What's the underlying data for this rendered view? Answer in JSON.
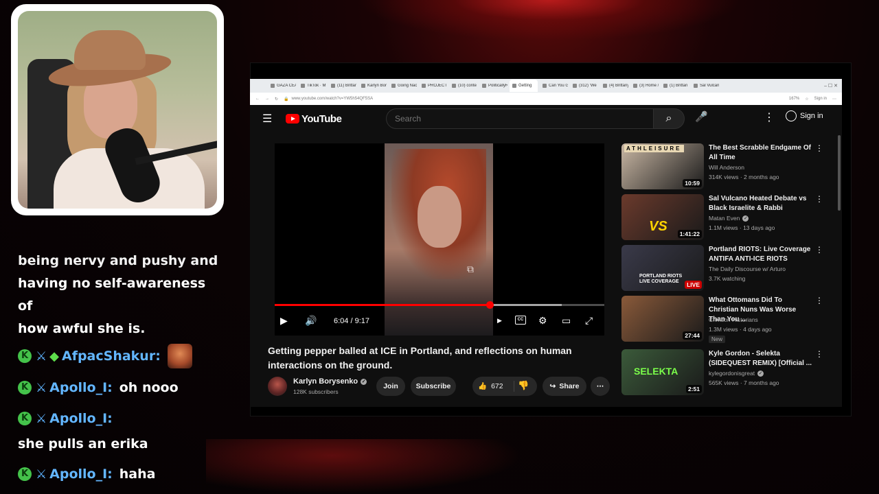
{
  "chat": {
    "clipped_line": "being nervy and pushy and",
    "lines": [
      "having no self-awareness of",
      "how awful she is."
    ],
    "messages": [
      {
        "user": "AfpacShakur:",
        "text": "",
        "has_emote": true
      },
      {
        "user": "Apollo_I:",
        "text": "oh nooo"
      },
      {
        "user": "Apollo_I:",
        "text": "she pulls an erika"
      },
      {
        "user": "Apollo_I:",
        "text": "haha"
      }
    ]
  },
  "browser": {
    "tabs": [
      "GAZA CEA",
      "TikTok · M",
      "(11) Brittan",
      "Karlyn Bory",
      "Going Nac",
      "PROJECT",
      "(10) conte",
      "PoliticallyR",
      "Getting",
      "Can You G",
      "(312) 'We",
      "(4) Brittany",
      "(3) Home /",
      "(1) Brittan",
      "Sal Vulcano"
    ],
    "url": "www.youtube.com/watch?v=YW5h54QF5SA",
    "zoom": "167%",
    "sign_in_small": "Sign in"
  },
  "youtube": {
    "logo_text": "YouTube",
    "search_placeholder": "Search",
    "signin": "Sign in",
    "player": {
      "time": "6:04 / 9:17",
      "progress_fraction": 0.653,
      "buffer_fraction": 0.87,
      "cc_label": "CC"
    },
    "title": "Getting pepper balled at ICE in Portland, and reflections on human interactions on the ground.",
    "channel": {
      "name": "Karlyn Borysenko",
      "subs": "128K subscribers"
    },
    "actions": {
      "join": "Join",
      "subscribe": "Subscribe",
      "likes": "672",
      "share": "Share"
    },
    "recommendations": [
      {
        "title": "The Best Scrabble Endgame Of All Time",
        "channel": "Will Anderson",
        "meta": "314K views · 2 months ago",
        "duration": "10:59",
        "thumb_color": "#c9b7a4"
      },
      {
        "title": "Sal Vulcano Heated Debate vs Black Israelite & Rabbi",
        "channel": "Matan Even",
        "meta": "1.1M views · 13 days ago",
        "duration": "1:41:22",
        "thumb_color": "#6b3a2c",
        "verified": true
      },
      {
        "title": "Portland RIOTS: Live Coverage ANTIFA ANTI-ICE RIOTS",
        "channel": "The Daily Discourse w/ Arturo",
        "meta": "3.7K watching",
        "live": "LIVE",
        "thumb_color": "#3a3a4a"
      },
      {
        "title": "What Ottomans Did To Christian Nuns Was Worse Than You ...",
        "channel": "Crimson Historians",
        "meta": "1.3M views · 4 days ago",
        "duration": "27:44",
        "new_badge": "New",
        "thumb_color": "#8a5a3a"
      },
      {
        "title": "Kyle Gordon - Selekta (SIDEQUEST REMIX) [Official ...",
        "channel": "kylegordonisgreat",
        "meta": "565K views · 7 months ago",
        "duration": "2:51",
        "thumb_color": "#3b5a3a",
        "verified": true,
        "thumb_text": "SELEKTA"
      }
    ],
    "thumb_labels": {
      "scrabble": "ATHLEISURE",
      "debate": "VS",
      "portland": "PORTLAND RIOTS LIVE COVERAGE"
    }
  }
}
